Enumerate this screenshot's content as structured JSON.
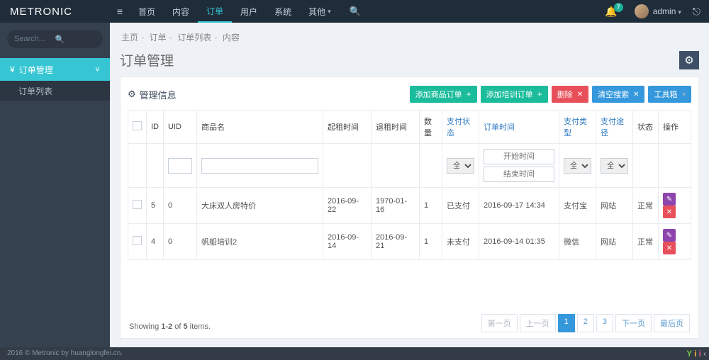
{
  "logo": {
    "a": "METR",
    "b": "ONIC"
  },
  "topnav": [
    "首页",
    "内容",
    "订单",
    "用户",
    "系统",
    "其他"
  ],
  "topnav_active": 2,
  "badge": "7",
  "username": "admin",
  "sidebar": {
    "search_ph": "Search...",
    "group": "订单管理",
    "sub": "订单列表"
  },
  "breadcrumb": [
    "主页",
    "订单",
    "订单列表",
    "内容"
  ],
  "page_title": "订单管理",
  "panel_title": "管理信息",
  "buttons": {
    "addGoods": "添加商品订单",
    "addTrain": "添加培训订单",
    "del": "删除",
    "clear": "清空搜索",
    "tools": "工具箱"
  },
  "columns": {
    "id": "ID",
    "uid": "UID",
    "name": "商品名",
    "start": "起租时间",
    "end": "退租时间",
    "qty": "数量",
    "payState": "支付状态",
    "orderTime": "订单时间",
    "payType": "支付类型",
    "payWay": "支付途径",
    "state": "状态",
    "op": "操作"
  },
  "filters": {
    "all": "全部",
    "startDate": "开始时间",
    "endDate": "结束时间"
  },
  "rows": [
    {
      "id": "5",
      "uid": "0",
      "name": "大床双人房特价",
      "start": "2016-09-22",
      "end": "1970-01-16",
      "qty": "1",
      "payState": "已支付",
      "orderTime": "2016-09-17 14:34",
      "payType": "支付宝",
      "payWay": "网站",
      "state": "正常"
    },
    {
      "id": "4",
      "uid": "0",
      "name": "帆船培训2",
      "start": "2016-09-14",
      "end": "2016-09-21",
      "qty": "1",
      "payState": "未支付",
      "orderTime": "2016-09-14 01:35",
      "payType": "微信",
      "payWay": "网站",
      "state": "正常"
    }
  ],
  "showing": {
    "a": "Showing ",
    "b": "1-2",
    "c": " of ",
    "d": "5",
    "e": " items."
  },
  "pager": {
    "first": "第一页",
    "prev": "上一页",
    "p1": "1",
    "p2": "2",
    "p3": "3",
    "next": "下一页",
    "last": "最后页"
  },
  "footer": "2016 © Metronic by huanglongfei.cn."
}
